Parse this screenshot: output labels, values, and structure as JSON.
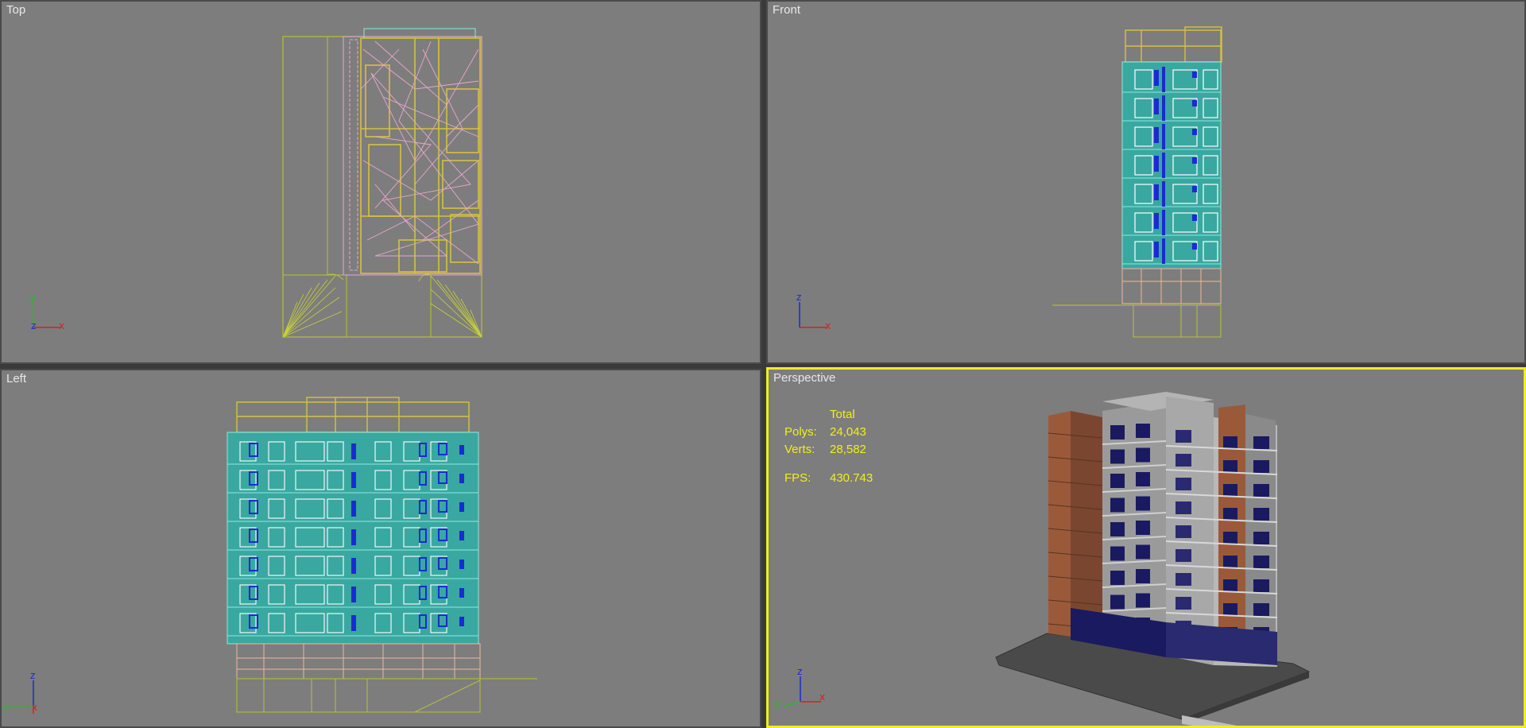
{
  "viewports": {
    "top": {
      "label": "Top"
    },
    "front": {
      "label": "Front"
    },
    "left": {
      "label": "Left"
    },
    "perspective": {
      "label": "Perspective",
      "stats_header": "Total",
      "polys_label": "Polys:",
      "polys_value": "24,043",
      "verts_label": "Verts:",
      "verts_value": "28,582",
      "fps_label": "FPS:",
      "fps_value": "430.743"
    }
  },
  "gizmos": {
    "top": {
      "up": "y",
      "right": "x",
      "origin": "z"
    },
    "front": {
      "up": "z",
      "right": "x"
    },
    "left": {
      "up": "z",
      "left": "y",
      "right": "x"
    },
    "perspective": {
      "up": "z",
      "left": "y",
      "right": "x"
    }
  },
  "colors": {
    "viewport_bg": "#7d7d7d",
    "active_border": "#f2ee1c",
    "wire_yellow": "#d6c23c",
    "wire_olive": "#b8c232",
    "wire_pink": "#e8a8cc",
    "wire_cyan": "#8fe8e0",
    "wire_teal": "#39a8a0",
    "wire_blue": "#1a2bd0",
    "wire_peach": "#f0b89a",
    "brick": "#9a5a3a",
    "concrete": "#a8a8a8"
  }
}
